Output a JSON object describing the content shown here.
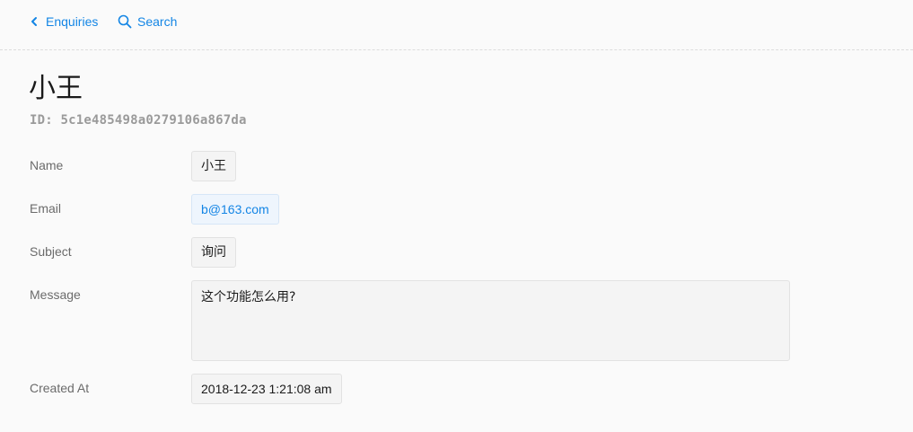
{
  "toolbar": {
    "back_label": "Enquiries",
    "back_icon": "chevron-left-icon",
    "search_label": "Search",
    "search_icon": "search-icon",
    "accent_color": "#1385e5"
  },
  "record": {
    "title": "小王",
    "id_text": "ID: 5c1e485498a0279106a867da"
  },
  "fields": {
    "name": {
      "label": "Name",
      "value": "小王"
    },
    "email": {
      "label": "Email",
      "value": "b@163.com"
    },
    "subject": {
      "label": "Subject",
      "value": "询问"
    },
    "message": {
      "label": "Message",
      "value": "这个功能怎么用?"
    },
    "created_at": {
      "label": "Created At",
      "value": "2018-12-23 1:21:08 am"
    }
  }
}
